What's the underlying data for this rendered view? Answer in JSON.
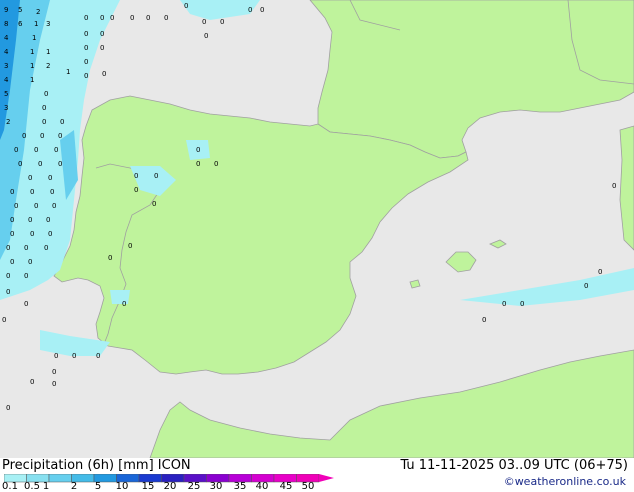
{
  "title": {
    "left": "Precipitation (6h) [mm] ICON",
    "right": "Tu 11-11-2025 03..09 UTC (06+75)",
    "copyright": "©weatheronline.co.uk"
  },
  "legend": {
    "labels": [
      "0.1",
      "0.5",
      "1",
      "2",
      "5",
      "10",
      "15",
      "20",
      "25",
      "30",
      "35",
      "40",
      "45",
      "50"
    ],
    "colors": [
      "#a8f0f5",
      "#88e0f0",
      "#66cfee",
      "#44bbe8",
      "#2299e0",
      "#1a66d8",
      "#1a3ad0",
      "#2a20c0",
      "#5a10c8",
      "#8a00d0",
      "#b800d8",
      "#d400d0",
      "#e800c8",
      "#f000b8"
    ]
  },
  "colors": {
    "sea": "#e8e8e8",
    "land": "#bff39c",
    "border": "#a0a0a0",
    "precip_light": "#a8f0f5",
    "precip_mid": "#66cfee",
    "precip_heavy": "#2299e0"
  },
  "precip_values": [
    "9",
    "5",
    "8",
    "6",
    "4",
    "4",
    "3",
    "4",
    "5",
    "3",
    "2",
    "1",
    "3",
    "1",
    "1",
    "1",
    "1",
    "2",
    "1",
    "1",
    "0",
    "2",
    "0",
    "0",
    "0",
    "0",
    "0",
    "0",
    "0",
    "0",
    "0",
    "0",
    "0",
    "0",
    "0",
    "0",
    "0",
    "0",
    "0",
    "0",
    "0",
    "0",
    "0",
    "0",
    "0",
    "0",
    "0",
    "0",
    "0",
    "0",
    "0",
    "0",
    "0",
    "0",
    "0",
    "0",
    "0",
    "0",
    "0",
    "0",
    "0",
    "0",
    "0",
    "0",
    "0",
    "0",
    "0",
    "0",
    "0",
    "0",
    "0",
    "0",
    "0",
    "0",
    "0",
    "0",
    "0",
    "0",
    "0",
    "0",
    "0",
    "0",
    "0",
    "0",
    "0",
    "0",
    "0",
    "0",
    "0",
    "0",
    "0",
    "0",
    "0",
    "0",
    "0",
    "0",
    "0",
    "0",
    "0",
    "0"
  ]
}
